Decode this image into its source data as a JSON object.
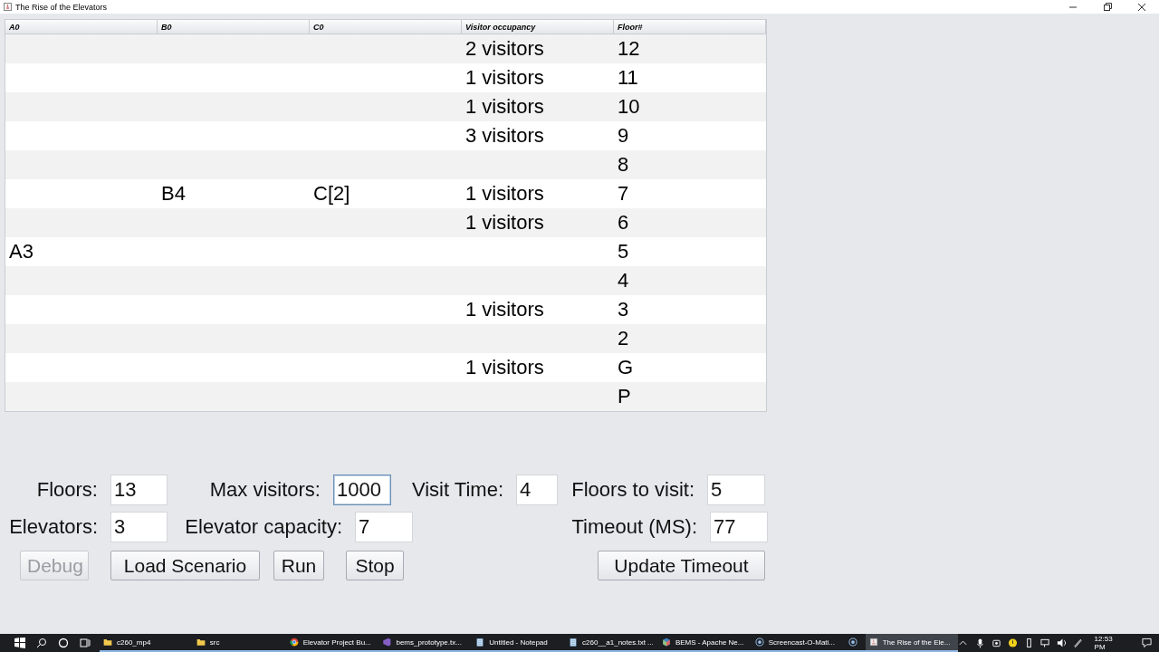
{
  "window": {
    "title": "The Rise of the Elevators"
  },
  "table": {
    "columns": [
      "A0",
      "B0",
      "C0",
      "Visitor occupancy",
      "Floor#"
    ],
    "rows": [
      [
        "",
        "",
        "",
        "2 visitors",
        "12"
      ],
      [
        "",
        "",
        "",
        "1 visitors",
        "11"
      ],
      [
        "",
        "",
        "",
        "1 visitors",
        "10"
      ],
      [
        "",
        "",
        "",
        "3 visitors",
        "9"
      ],
      [
        "",
        "",
        "",
        "",
        "8"
      ],
      [
        "",
        "B4",
        "C[2]",
        "1 visitors",
        "7"
      ],
      [
        "",
        "",
        "",
        "1 visitors",
        "6"
      ],
      [
        "A3",
        "",
        "",
        "",
        "5"
      ],
      [
        "",
        "",
        "",
        "",
        "4"
      ],
      [
        "",
        "",
        "",
        "1 visitors",
        "3"
      ],
      [
        "",
        "",
        "",
        "",
        "2"
      ],
      [
        "",
        "",
        "",
        "1 visitors",
        "G"
      ],
      [
        "",
        "",
        "",
        "",
        "P"
      ]
    ]
  },
  "form": {
    "rows": [
      [
        {
          "label": "Floors:",
          "value": "13",
          "focused": false
        },
        {
          "label": "Max visitors:",
          "value": "1000",
          "focused": true
        },
        {
          "label": "Visit Time:",
          "value": "4",
          "focused": false
        },
        {
          "label": "Floors to visit:",
          "value": "5",
          "focused": false
        }
      ],
      [
        {
          "label": "Elevators:",
          "value": "3",
          "focused": false
        },
        {
          "label": "Elevator capacity:",
          "value": "7",
          "focused": false
        },
        "",
        {
          "label": "Timeout (MS):",
          "value": "77",
          "focused": false
        }
      ]
    ],
    "buttons": [
      {
        "label": "Debug",
        "disabled": true
      },
      {
        "label": "Load Scenario",
        "disabled": false
      },
      {
        "label": "Run",
        "disabled": false
      },
      {
        "label": "Stop",
        "disabled": false
      },
      {
        "label": "Update Timeout",
        "disabled": false
      }
    ]
  },
  "taskbar": {
    "items": [
      {
        "kind": "folder",
        "label": "c260_mp4",
        "active": false
      },
      {
        "kind": "folder",
        "label": "src",
        "active": false
      },
      {
        "kind": "browser",
        "label": "Elevator Project Bu...",
        "active": false
      },
      {
        "kind": "editor",
        "label": "bems_prototype.tx...",
        "active": false
      },
      {
        "kind": "notepad",
        "label": "Untitled - Notepad",
        "active": false
      },
      {
        "kind": "notepad",
        "label": "c260__a1_notes.txt ...",
        "active": false
      },
      {
        "kind": "ide",
        "label": "BEMS - Apache Ne...",
        "active": false
      },
      {
        "kind": "recorder",
        "label": "Screencast-O-Mati...",
        "active": false
      },
      {
        "kind": "recorder",
        "active": false
      },
      {
        "kind": "java",
        "label": "The Rise of the Ele...",
        "active": true
      }
    ],
    "clock": "12:53 PM"
  }
}
